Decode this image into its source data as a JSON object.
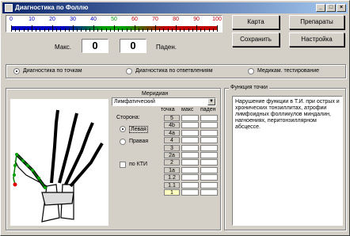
{
  "window": {
    "title": "Диагностика по Фоллю"
  },
  "scale": {
    "ticks": [
      "0",
      "10",
      "20",
      "30",
      "40",
      "50",
      "60",
      "70",
      "80",
      "90",
      "100"
    ]
  },
  "readout": {
    "max_label": "Макс.",
    "max_value": "0",
    "min_value": "0",
    "fall_label": "Паден."
  },
  "buttons": {
    "map": "Карта",
    "drugs": "Препараты",
    "save": "Сохранить",
    "settings": "Настройка"
  },
  "modes": [
    {
      "label": "Диагностика по точкам",
      "selected": true
    },
    {
      "label": "Диагностика по ответвлениям",
      "selected": false
    },
    {
      "label": "Медикам. тестирование",
      "selected": false
    }
  ],
  "meridian": {
    "label": "Меридиан",
    "value": "Лимфатический"
  },
  "side": {
    "label": "Сторона:",
    "options": [
      {
        "label": "Левая",
        "selected": true
      },
      {
        "label": "Правая",
        "selected": false
      }
    ]
  },
  "kti": {
    "label": "по КТИ",
    "checked": false
  },
  "table": {
    "headers": [
      "точка",
      "макс",
      "паден"
    ],
    "points": [
      "5",
      "4b",
      "4a",
      "4",
      "3",
      "2a",
      "2",
      "1a",
      "1.2",
      "1.1",
      "1"
    ]
  },
  "function": {
    "label": "Функция точки",
    "text": "Нарушение функции в Т.И. при острых и хронических тонзиллитах, атрофии лимфоидных фолликулов миндалин, нагноениях, перитонзиллярном абсцессе."
  }
}
